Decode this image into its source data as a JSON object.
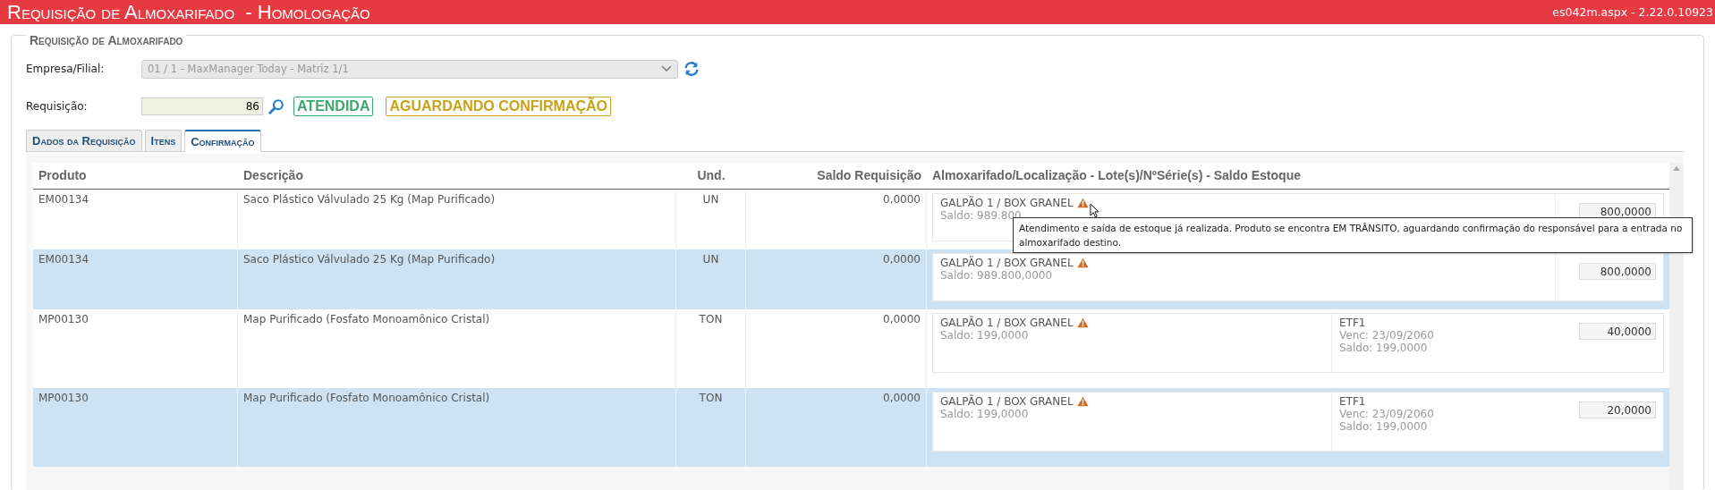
{
  "header": {
    "title": "Requisição de Almoxarifado  - Homologação",
    "version": "es042m.aspx - 2.22.0.10923"
  },
  "form": {
    "legend": "Requisição de Almoxarifado",
    "empresa_label": "Empresa/Filial:",
    "empresa_value": "01 / 1 - MaxManager Today - Matriz 1/1",
    "empresa_disabled": true,
    "requisicao_label": "Requisição:",
    "requisicao_value": "86",
    "badges": [
      {
        "label": "ATENDIDA",
        "color": "#3aa76d"
      },
      {
        "label": "AGUARDANDO CONFIRMAÇÃO",
        "color": "#c9a21a"
      }
    ]
  },
  "tabs": [
    {
      "label": "Dados da Requisição",
      "selected": false
    },
    {
      "label": "Itens",
      "selected": false
    },
    {
      "label": "Confirmação",
      "selected": true
    }
  ],
  "table": {
    "columns": [
      "Produto",
      "Descrição",
      "Und.",
      "Saldo Requisição",
      "Almoxarifado/Localização - Lote(s)/NºSérie(s) - Saldo Estoque"
    ],
    "rows": [
      {
        "produto": "EM00134",
        "descricao": "Saco Plástico Válvulado 25 Kg (Map Purificado)",
        "und": "UN",
        "saldo": "0,0000",
        "selected": false,
        "local": "GALPÃO 1 / BOX GRANEL",
        "local_saldo": "Saldo: 989.800",
        "quantidade": "800,0000",
        "tooltip": "Atendimento e saída de estoque já realizada. Produto se encontra EM TRÂNSITO, aguardando confirmação do responsável para a entrada no almoxarifado destino."
      },
      {
        "produto": "EM00134",
        "descricao": "Saco Plástico Válvulado 25 Kg (Map Purificado)",
        "und": "UN",
        "saldo": "0,0000",
        "selected": true,
        "local": "GALPÃO 1 / BOX GRANEL",
        "local_saldo": "Saldo: 989.800,0000",
        "quantidade": "800,0000"
      },
      {
        "produto": "MP00130",
        "descricao": "Map Purificado (Fosfato Monoamônico Cristal)",
        "und": "TON",
        "saldo": "0,0000",
        "selected": false,
        "local": "GALPÃO 1 / BOX GRANEL",
        "local_saldo": "Saldo: 199,0000",
        "lote": "ETF1",
        "lote_venc": "Venc: 23/09/2060",
        "lote_saldo": "Saldo: 199,0000",
        "quantidade": "40,0000"
      },
      {
        "produto": "MP00130",
        "descricao": "Map Purificado (Fosfato Monoamônico Cristal)",
        "und": "TON",
        "saldo": "0,0000",
        "selected": true,
        "local": "GALPÃO 1 / BOX GRANEL",
        "local_saldo": "Saldo: 199,0000",
        "lote": "ETF1",
        "lote_venc": "Venc: 23/09/2060",
        "lote_saldo": "Saldo: 199,0000",
        "quantidade": "20,0000"
      }
    ]
  }
}
